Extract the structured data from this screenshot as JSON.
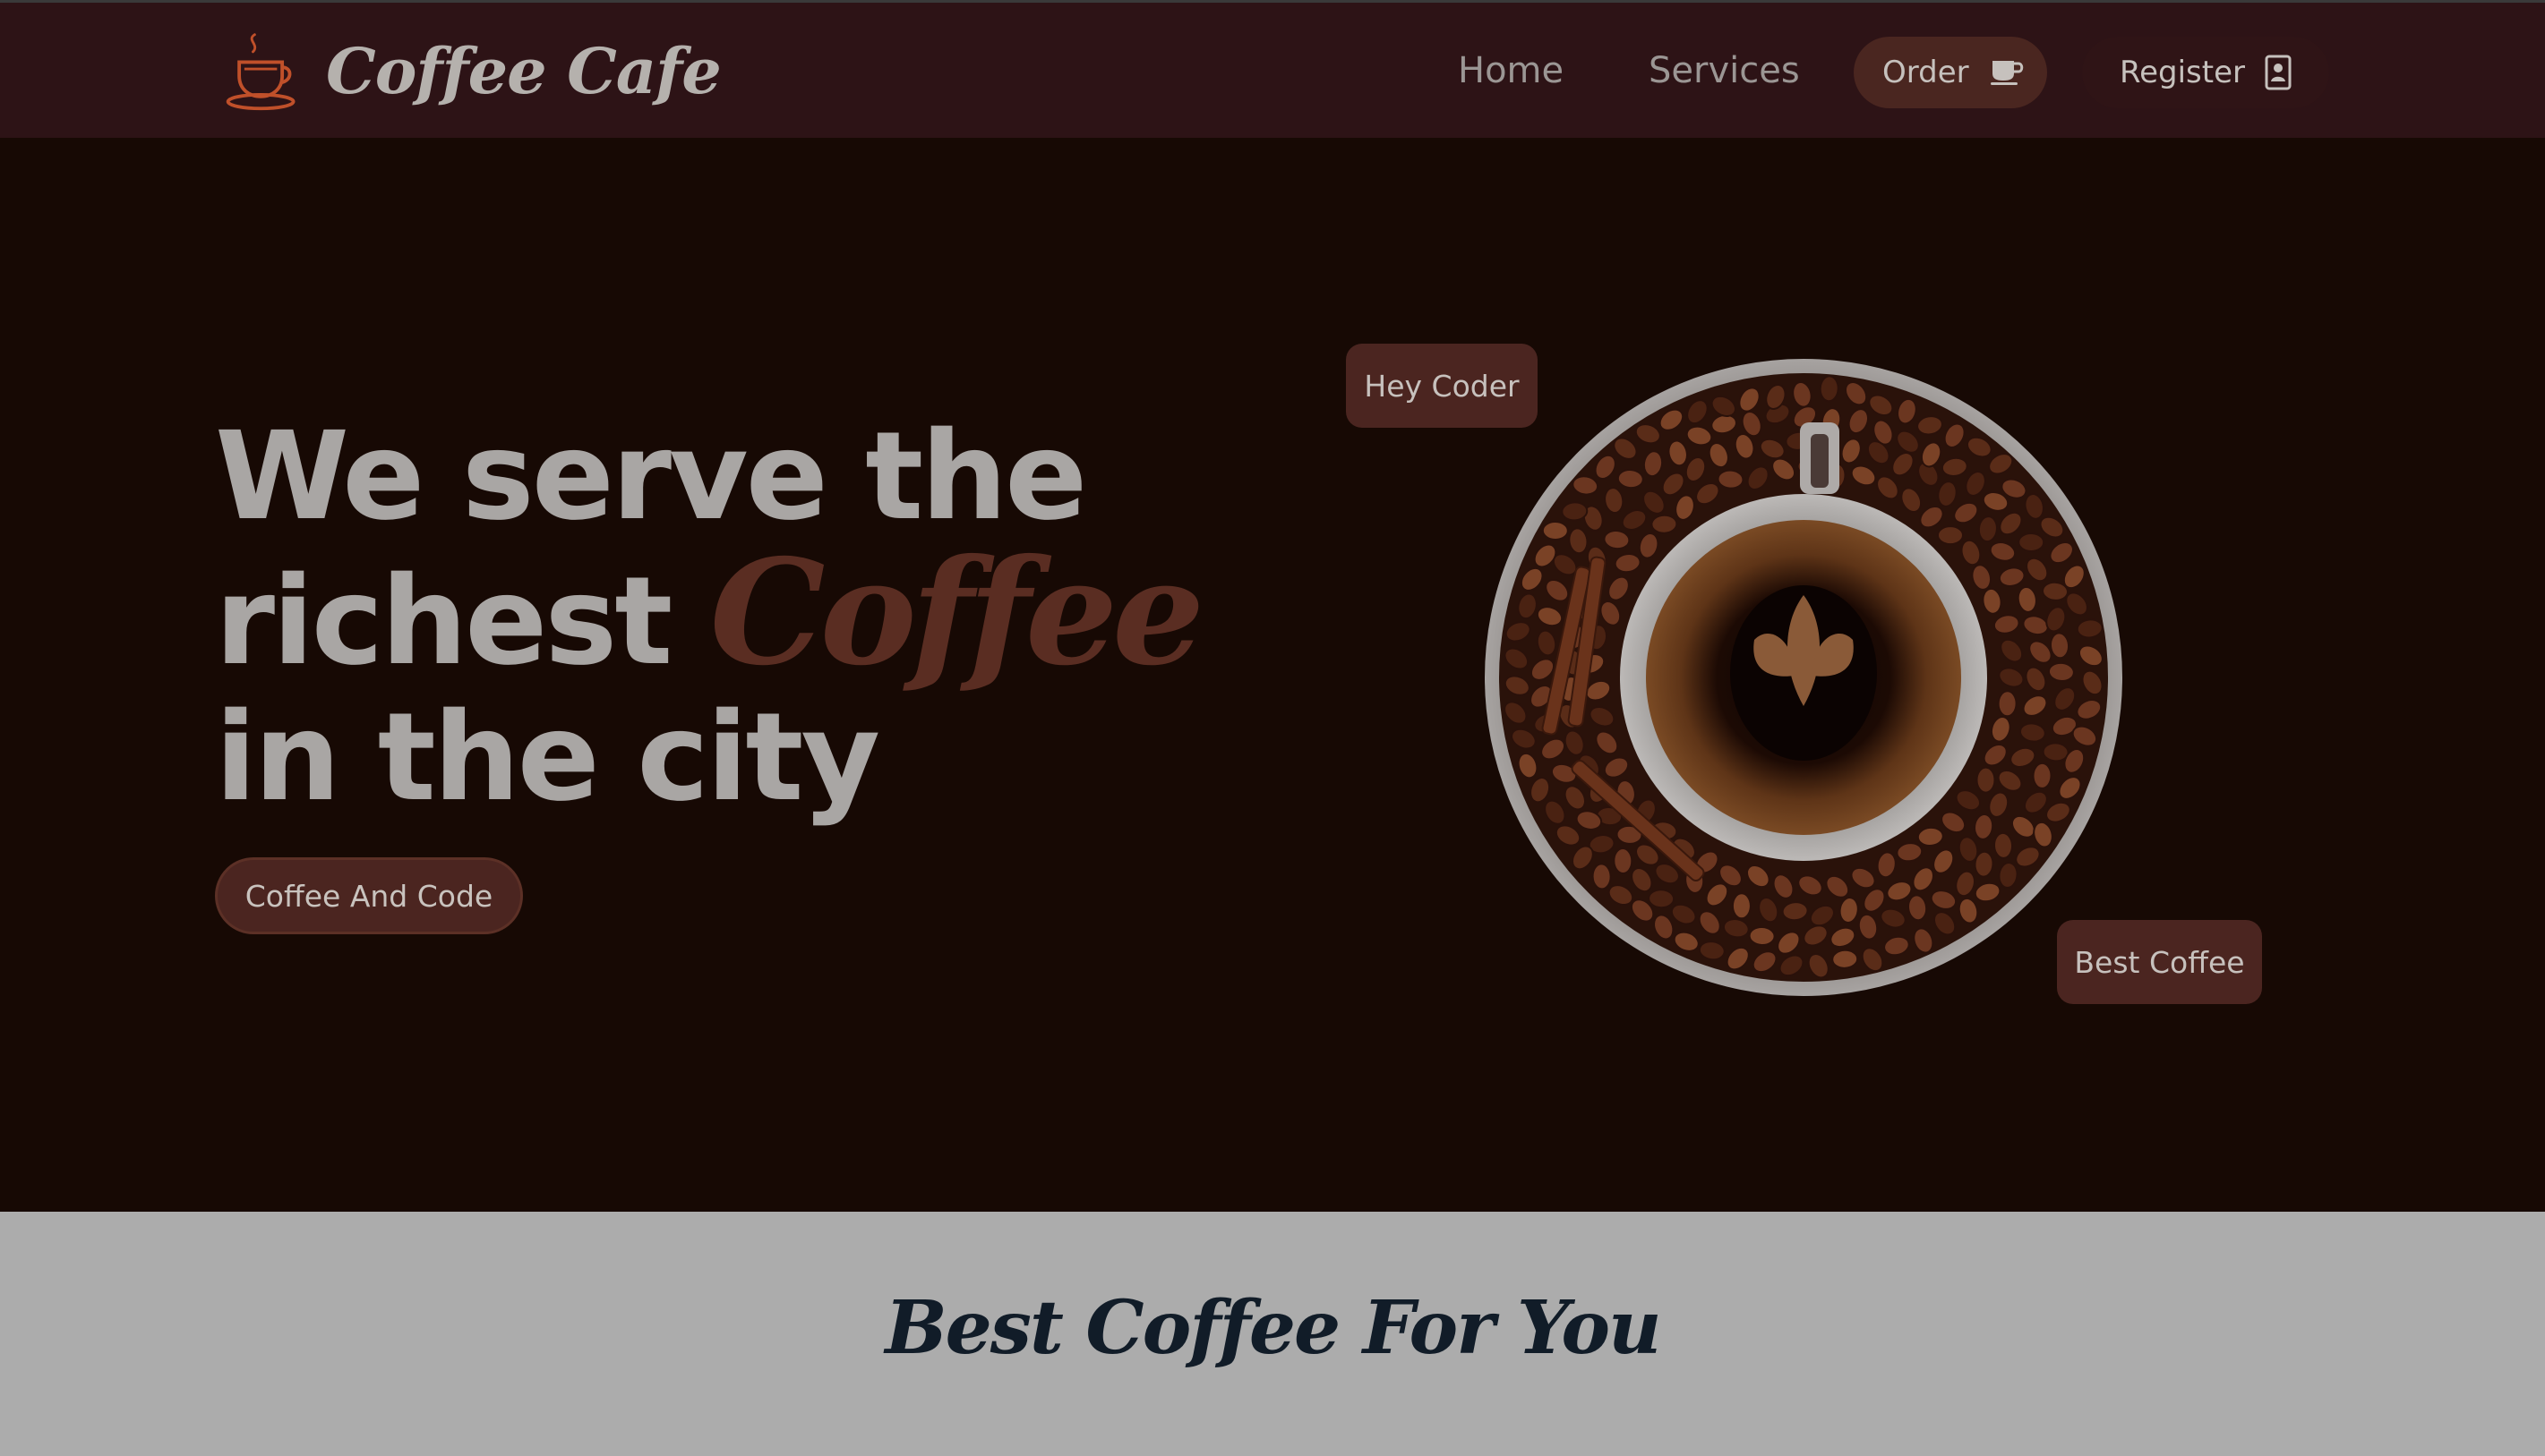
{
  "navbar": {
    "brand_name": "Coffee Cafe",
    "brand_icon": "coffee-cup-icon",
    "links": [
      {
        "label": "Home"
      },
      {
        "label": "Services"
      }
    ],
    "order_button": {
      "label": "Order",
      "icon": "coffee-cup-icon"
    },
    "register_button": {
      "label": "Register",
      "icon": "id-badge-icon"
    }
  },
  "hero": {
    "headline_part1": "We serve the richest ",
    "headline_accent": "Coffee",
    "headline_part2": " in the city",
    "cta_label": "Coffee And Code",
    "tag_top": "Hey Coder",
    "tag_bottom": "Best Coffee",
    "image": "coffee-cup-on-beans"
  },
  "section": {
    "title": "Best Coffee For You"
  },
  "colors": {
    "navbar_bg": "#2d1316",
    "hero_bg": "#170904",
    "accent_brown": "#4b2520",
    "accent_text": "#5a2d22",
    "brand_icon_color": "#c0502a",
    "section_bg": "#acacac",
    "section_title": "#111c28"
  }
}
